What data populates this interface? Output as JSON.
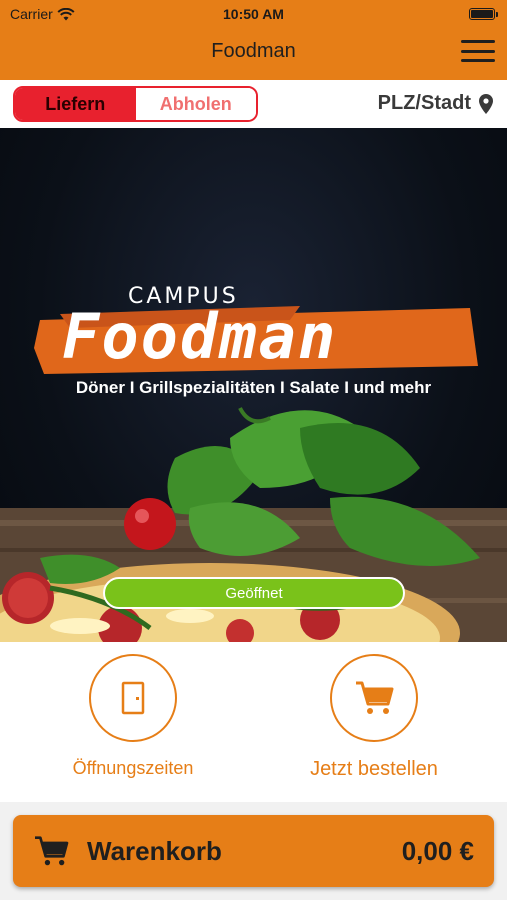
{
  "status_bar": {
    "carrier": "Carrier",
    "time": "10:50 AM"
  },
  "nav": {
    "title": "Foodman"
  },
  "order_mode": {
    "options": [
      "Liefern",
      "Abholen"
    ],
    "selected": "Liefern"
  },
  "location": {
    "label": "PLZ/Stadt"
  },
  "hero": {
    "logo_small": "CAMPUS",
    "logo_main": "Foodman",
    "tagline": "Döner I Grillspezialitäten I Salate I und mehr",
    "open_status": "Geöffnet"
  },
  "actions": [
    {
      "label": "Öffnungszeiten",
      "icon": "door-icon"
    },
    {
      "label": "Jetzt bestellen",
      "icon": "cart-icon"
    }
  ],
  "cart": {
    "label": "Warenkorb",
    "total": "0,00 €"
  },
  "colors": {
    "brand_orange": "#e67e17",
    "red": "#e8212e",
    "green": "#7ac21a"
  }
}
